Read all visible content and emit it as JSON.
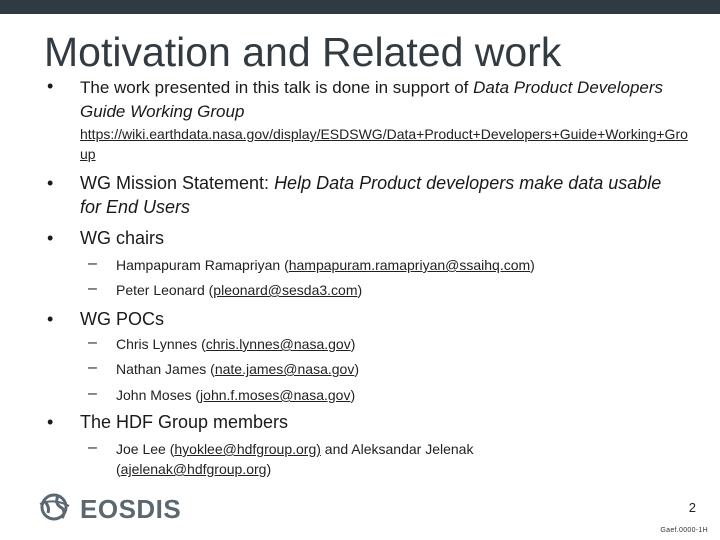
{
  "slide": {
    "title": "Motivation and Related work",
    "intro": {
      "text_before": "The work presented in this talk is done in support of ",
      "italic": "Data Product Developers Guide Working Group",
      "url": "https://wiki.earthdata.nasa.gov/display/ESDSWG/Data+Product+Developers+Guide+Working+Group"
    },
    "mission": {
      "label": "WG Mission Statement: ",
      "italic": "Help Data Product developers make data usable for End Users"
    },
    "chairs": {
      "heading": "WG chairs",
      "items": [
        {
          "name": "Hampapuram Ramapriyan (",
          "email": "hampapuram.ramapriyan@ssaihq.com",
          "close": ")"
        },
        {
          "name": "Peter Leonard (",
          "email": "pleonard@sesda3.com",
          "close": ")"
        }
      ]
    },
    "pocs": {
      "heading": "WG POCs",
      "items": [
        {
          "name": "Chris Lynnes (",
          "email": "chris.lynnes@nasa.gov",
          "close": ")"
        },
        {
          "name": "Nathan James (",
          "email": "nate.james@nasa.gov",
          "close": ")"
        },
        {
          "name": "John Moses (",
          "email": "john.f.moses@nasa.gov",
          "close": ")"
        }
      ]
    },
    "hdf": {
      "heading": "The HDF Group members",
      "item": {
        "part1": "Joe Lee (",
        "email1": "hyoklee@hdfgroup.org)",
        "part2": " and Aleksandar Jelenak (",
        "email2": "ajelenak@hdfgroup.org",
        "close": ")"
      }
    },
    "footer": {
      "logo_text": "EOSDIS",
      "page_number": "2",
      "code": "Gaef.0000-1H",
      "logo_icon": "globe-icon"
    },
    "colors": {
      "topbar": "#2f3a44",
      "logo": "#5c6870"
    },
    "bullet_glyph": "•",
    "dash_glyph": "–"
  }
}
